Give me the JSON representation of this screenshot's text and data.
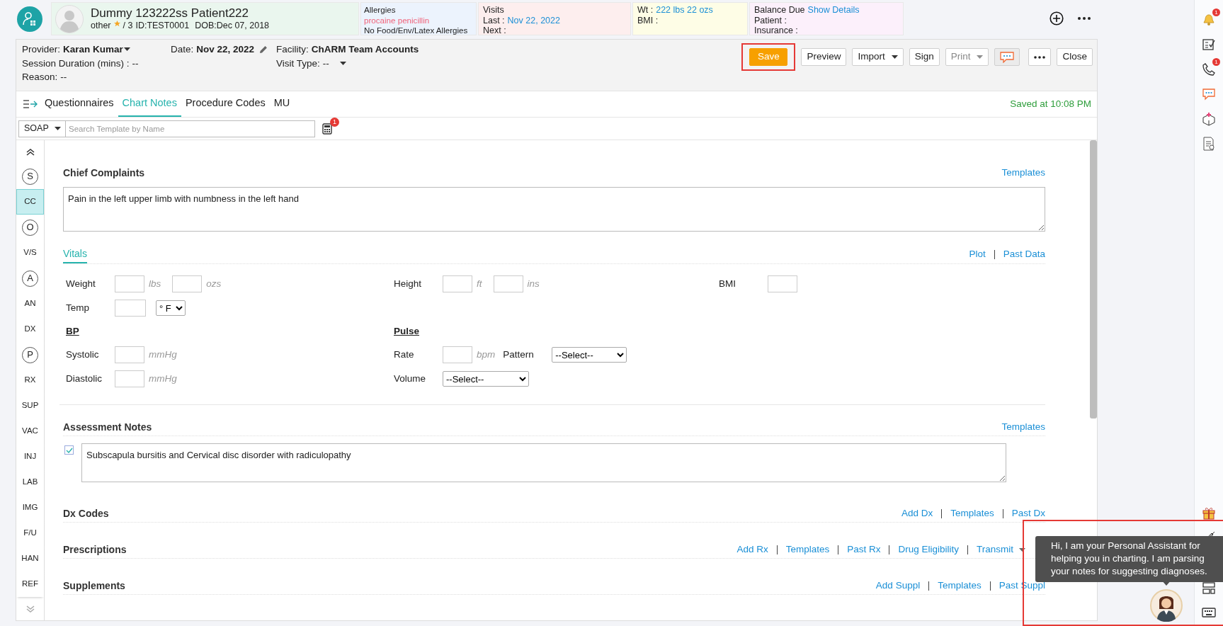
{
  "header": {
    "patient": {
      "name": "Dummy 123222ss Patient222",
      "gender": "other",
      "starred": true,
      "visit_count": "/ 3",
      "id": "ID:TEST0001",
      "dob": "DOB:Dec 07, 2018"
    },
    "allergies": {
      "title": "Allergies",
      "drug": "procaine penicillin",
      "other": "No Food/Env/Latex Allergies"
    },
    "visits": {
      "title": "Visits",
      "rows": [
        {
          "label": "Last :",
          "value": "Nov 22, 2022"
        },
        {
          "label": "Next :"
        }
      ]
    },
    "measures": {
      "rows": [
        {
          "label": "Wt :",
          "value": "222 lbs 22 ozs"
        },
        {
          "label": "BMI :"
        }
      ]
    },
    "balance": {
      "title": "Balance Due",
      "link": "Show Details",
      "rows": [
        {
          "label": "Patient :"
        },
        {
          "label": "Insurance :"
        }
      ]
    }
  },
  "toolbar": {
    "columns": [
      [
        {
          "label": "Provider:",
          "value": "Karan Kumar",
          "kind": "dropdown",
          "bold": true
        },
        {
          "label": "Session Duration (mins) :",
          "value": "--",
          "kind": "text",
          "bold": false
        },
        {
          "label": "Reason:",
          "value": "--",
          "kind": "text",
          "bold": false
        }
      ],
      [
        {
          "label": "Date:",
          "value": "Nov 22, 2022",
          "kind": "editable",
          "bold": true
        }
      ],
      [
        {
          "label": "Facility:",
          "value": "ChARM Team Accounts",
          "kind": "text",
          "bold": true
        },
        {
          "label": "Visit Type:",
          "value": "--",
          "kind": "dropdown",
          "bold": false
        }
      ]
    ],
    "buttons": [
      {
        "label": "Save",
        "kind": "primary",
        "disabled": false,
        "highlighted": true
      },
      {
        "label": "Preview",
        "kind": "plain",
        "disabled": false,
        "highlighted": false
      },
      {
        "label": "Import",
        "kind": "dropdown",
        "disabled": false,
        "highlighted": false
      },
      {
        "label": "Sign",
        "kind": "plain",
        "disabled": false,
        "highlighted": false
      },
      {
        "label": "Print",
        "kind": "dropdown",
        "disabled": true,
        "highlighted": false
      },
      {
        "kind": "chat",
        "disabled": false,
        "highlighted": false
      },
      {
        "kind": "more",
        "disabled": false,
        "highlighted": false
      },
      {
        "label": "Close",
        "kind": "plain",
        "disabled": false,
        "highlighted": false
      }
    ]
  },
  "tabs": [
    {
      "label": "Questionnaires",
      "selected": false
    },
    {
      "label": "Chart Notes",
      "selected": true
    },
    {
      "label": "Procedure Codes",
      "selected": false
    },
    {
      "label": "MU",
      "selected": false
    }
  ],
  "saved_status": "Saved at 10:08 PM",
  "template_bar": {
    "type": "SOAP",
    "placeholder": "Search Template by Name",
    "badge": "1"
  },
  "sidebar": [
    {
      "label": "S",
      "kind": "group",
      "selected": false
    },
    {
      "label": "CC",
      "kind": "item",
      "selected": true
    },
    {
      "label": "O",
      "kind": "group",
      "selected": false
    },
    {
      "label": "V/S",
      "kind": "item",
      "selected": false
    },
    {
      "label": "A",
      "kind": "group",
      "selected": false
    },
    {
      "label": "AN",
      "kind": "item",
      "selected": false
    },
    {
      "label": "DX",
      "kind": "item",
      "selected": false
    },
    {
      "label": "P",
      "kind": "group",
      "selected": false
    },
    {
      "label": "RX",
      "kind": "item",
      "selected": false
    },
    {
      "label": "SUP",
      "kind": "item",
      "selected": false
    },
    {
      "label": "VAC",
      "kind": "item",
      "selected": false
    },
    {
      "label": "INJ",
      "kind": "item",
      "selected": false
    },
    {
      "label": "LAB",
      "kind": "item",
      "selected": false
    },
    {
      "label": "IMG",
      "kind": "item",
      "selected": false
    },
    {
      "label": "F/U",
      "kind": "item",
      "selected": false
    },
    {
      "label": "HAN",
      "kind": "item",
      "selected": false
    },
    {
      "label": "REF",
      "kind": "item",
      "selected": false
    }
  ],
  "sections": [
    {
      "kind": "text",
      "title": "Chief Complaints",
      "links": [
        "Templates"
      ],
      "value": "Pain in the left upper limb with numbness in the left hand"
    },
    {
      "kind": "vitals",
      "tab": "Vitals",
      "links": [
        "Plot",
        "Past Data"
      ],
      "rows": [
        {
          "cells": [
            {
              "kind": "field",
              "label": "Weight",
              "controls": [
                {
                  "kind": "input",
                  "unit": "lbs"
                },
                {
                  "kind": "input",
                  "unit": "ozs"
                }
              ]
            },
            {
              "kind": "field",
              "label": "Height",
              "controls": [
                {
                  "kind": "input",
                  "unit": "ft"
                },
                {
                  "kind": "input",
                  "unit": "ins"
                }
              ]
            },
            {
              "kind": "field",
              "label": "BMI",
              "controls": [
                {
                  "kind": "input"
                }
              ]
            }
          ]
        },
        {
          "cells": [
            {
              "kind": "field",
              "label": "Temp",
              "controls": [
                {
                  "kind": "input"
                },
                {
                  "kind": "select",
                  "value": "° F"
                }
              ]
            }
          ]
        },
        {
          "cells": [
            {
              "kind": "heading",
              "label": "BP"
            },
            {
              "kind": "heading",
              "label": "Pulse"
            }
          ]
        },
        {
          "cells": [
            {
              "kind": "field",
              "label": "Systolic",
              "controls": [
                {
                  "kind": "input",
                  "unit": "mmHg"
                }
              ]
            },
            {
              "kind": "field",
              "label": "Rate",
              "controls": [
                {
                  "kind": "input",
                  "unit": "bpm"
                },
                {
                  "kind": "text",
                  "label": "Pattern"
                },
                {
                  "kind": "select",
                  "value": "--Select--"
                }
              ]
            }
          ]
        },
        {
          "cells": [
            {
              "kind": "field",
              "label": "Diastolic",
              "controls": [
                {
                  "kind": "input",
                  "unit": "mmHg"
                }
              ]
            },
            {
              "kind": "field",
              "label": "Volume",
              "controls": [
                {
                  "kind": "select",
                  "value": "--Select--"
                }
              ]
            }
          ]
        }
      ]
    },
    {
      "kind": "checked-text",
      "title": "Assessment Notes",
      "links": [
        "Templates"
      ],
      "checked": true,
      "value": "Subscapula bursitis and Cervical disc disorder with radiculopathy"
    },
    {
      "kind": "links",
      "title": "Dx Codes",
      "links": [
        "Add Dx",
        "Templates",
        "Past Dx"
      ]
    },
    {
      "kind": "links",
      "title": "Prescriptions",
      "links": [
        "Add Rx",
        "Templates",
        "Past Rx",
        "Drug Eligibility"
      ],
      "menu_link": "Transmit"
    },
    {
      "kind": "links",
      "title": "Supplements",
      "links": [
        "Add Suppl",
        "Templates",
        "Past Suppl"
      ]
    }
  ],
  "rail": {
    "top_icons": [
      {
        "kind": "bell",
        "badge": "1"
      },
      {
        "kind": "checklist"
      },
      {
        "kind": "phone",
        "badge": "1"
      },
      {
        "kind": "chat"
      },
      {
        "kind": "box"
      },
      {
        "kind": "document"
      }
    ],
    "bottom_icons": [
      {
        "kind": "gift"
      },
      {
        "kind": "pen"
      }
    ],
    "dock_icons": [
      {
        "kind": "layout"
      },
      {
        "kind": "keyboard"
      }
    ]
  },
  "assistant": {
    "message": "Hi, I am your Personal Assistant for helping you in charting. I am parsing your notes for suggesting diagnoses.",
    "highlighted": true
  }
}
